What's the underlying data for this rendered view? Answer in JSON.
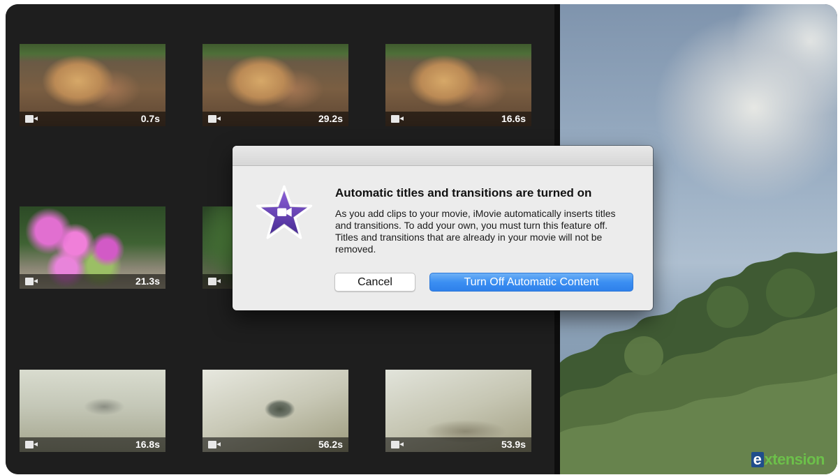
{
  "clips": [
    {
      "duration": "0.7s",
      "thumb": "t-log"
    },
    {
      "duration": "29.2s",
      "thumb": "t-log"
    },
    {
      "duration": "16.6s",
      "thumb": "t-log"
    },
    {
      "duration": "21.3s",
      "thumb": "t-flower"
    },
    {
      "duration": "",
      "thumb": "t-flower2"
    },
    {
      "duration": "16.8s",
      "thumb": "t-water"
    },
    {
      "duration": "56.2s",
      "thumb": "t-water2"
    },
    {
      "duration": "53.9s",
      "thumb": "t-water3"
    }
  ],
  "dialog": {
    "title": "Automatic titles and transitions are turned on",
    "message": "As you add clips to your movie, iMovie automatically inserts titles and transitions. To add your own, you must turn this feature off. Titles and transitions that are already in your movie will not be removed.",
    "cancel_label": "Cancel",
    "confirm_label": "Turn Off Automatic Content",
    "icon": "imovie-star-icon"
  },
  "watermark": {
    "letter": "e",
    "text": "xtension"
  },
  "colors": {
    "accent": "#3b8ff2",
    "browser_bg": "#1e1e1e",
    "icon_purple": "#5a3fa3"
  }
}
